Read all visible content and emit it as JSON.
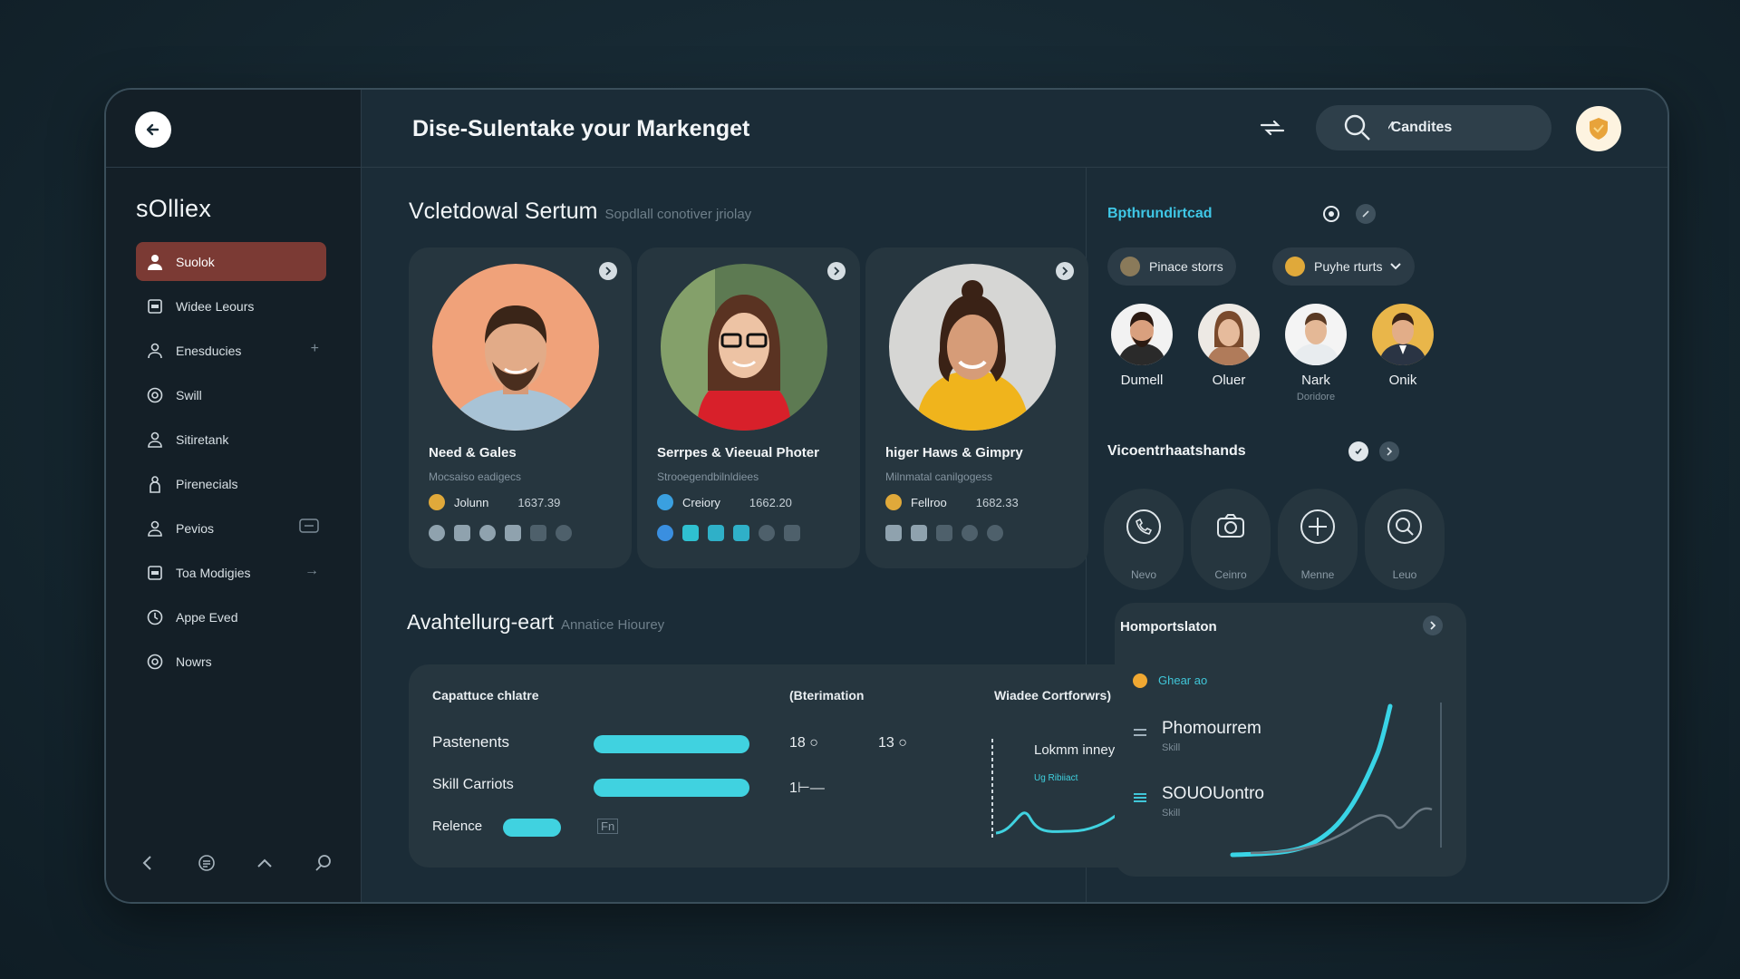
{
  "header": {
    "title": "Dise-Sulentake your Markenget",
    "search_value": "⁄Candites"
  },
  "sidebar": {
    "brand": "sOlliex",
    "items": [
      {
        "label": "Suolok",
        "icon": "person-icon",
        "active": true
      },
      {
        "label": "Widee Leours",
        "icon": "grid-icon"
      },
      {
        "label": "Enesducies",
        "icon": "person-icon",
        "trail": "+"
      },
      {
        "label": "Swill",
        "icon": "target-icon"
      },
      {
        "label": "Sitiretank",
        "icon": "person-icon"
      },
      {
        "label": "Pirenecials",
        "icon": "person-icon"
      },
      {
        "label": "Pevios",
        "icon": "person-icon",
        "trail": "□"
      },
      {
        "label": "Toa Modigies",
        "icon": "grid-icon",
        "trail": "→"
      },
      {
        "label": "Appe Eved",
        "icon": "clock-icon"
      },
      {
        "label": "Nowrs",
        "icon": "target-icon"
      }
    ]
  },
  "main": {
    "featured_title": "Vcletdowal Sertum",
    "featured_sub": "Sopdlall conotiver jriolay",
    "cards": [
      {
        "name": "Need & Gales",
        "role": "Mocsaiso eadigecs",
        "tag": "Jolunn",
        "num": "1637.39",
        "tag_color": "#e0a93a"
      },
      {
        "name": "Serrpes & Vieeual Photer",
        "role": "Strooegendbilnldiees",
        "tag": "Creiory",
        "num": "1662.20",
        "tag_color": "#3aa0e0"
      },
      {
        "name": "higer Haws & Gimpry",
        "role": "Milnmatal canilgogess",
        "tag": "Fellroo",
        "num": "1682.33",
        "tag_color": "#e0a93a"
      }
    ],
    "analytics_title": "Avahtellurg-eart",
    "analytics_sub": "Annatice Hiourey",
    "stats": {
      "col1": "Capattuce chlatre",
      "col2": "(Bterimation",
      "col3": "Wiadee Cortforwrs)",
      "rows": [
        {
          "label": "Pastenents",
          "v1": "18 ○",
          "v2": "13 ○"
        },
        {
          "label": "Skill Carriots",
          "v1": "1⊢—"
        },
        {
          "label": "Relence",
          "v1": "Fn"
        }
      ],
      "chart_label": "Lokmm inney",
      "chart_sub": "Ug Ribiiact"
    }
  },
  "right": {
    "title": "Bpthrundirtcad",
    "chip1": "Pinace storrs",
    "chip2": "Puyhe rturts",
    "people": [
      {
        "name": "Dumell",
        "sub": ""
      },
      {
        "name": "Oluer",
        "sub": ""
      },
      {
        "name": "Nark",
        "sub": "Doridore"
      },
      {
        "name": "Onik",
        "sub": ""
      }
    ],
    "tools_title": "Vicoentrhaatshands",
    "tools": [
      {
        "label": "Nevo",
        "icon": "phone-icon"
      },
      {
        "label": "Ceinro",
        "icon": "camera-icon"
      },
      {
        "label": "Menne",
        "icon": "plus-icon"
      },
      {
        "label": "Leuo",
        "icon": "search-icon"
      }
    ],
    "perf_title": "Homportslaton",
    "perf_legend": "Ghear ao",
    "perf_items": [
      {
        "label": "Phomourrem",
        "sub": "Skill"
      },
      {
        "label": "SOUOUontro",
        "sub": "Skill"
      }
    ]
  }
}
